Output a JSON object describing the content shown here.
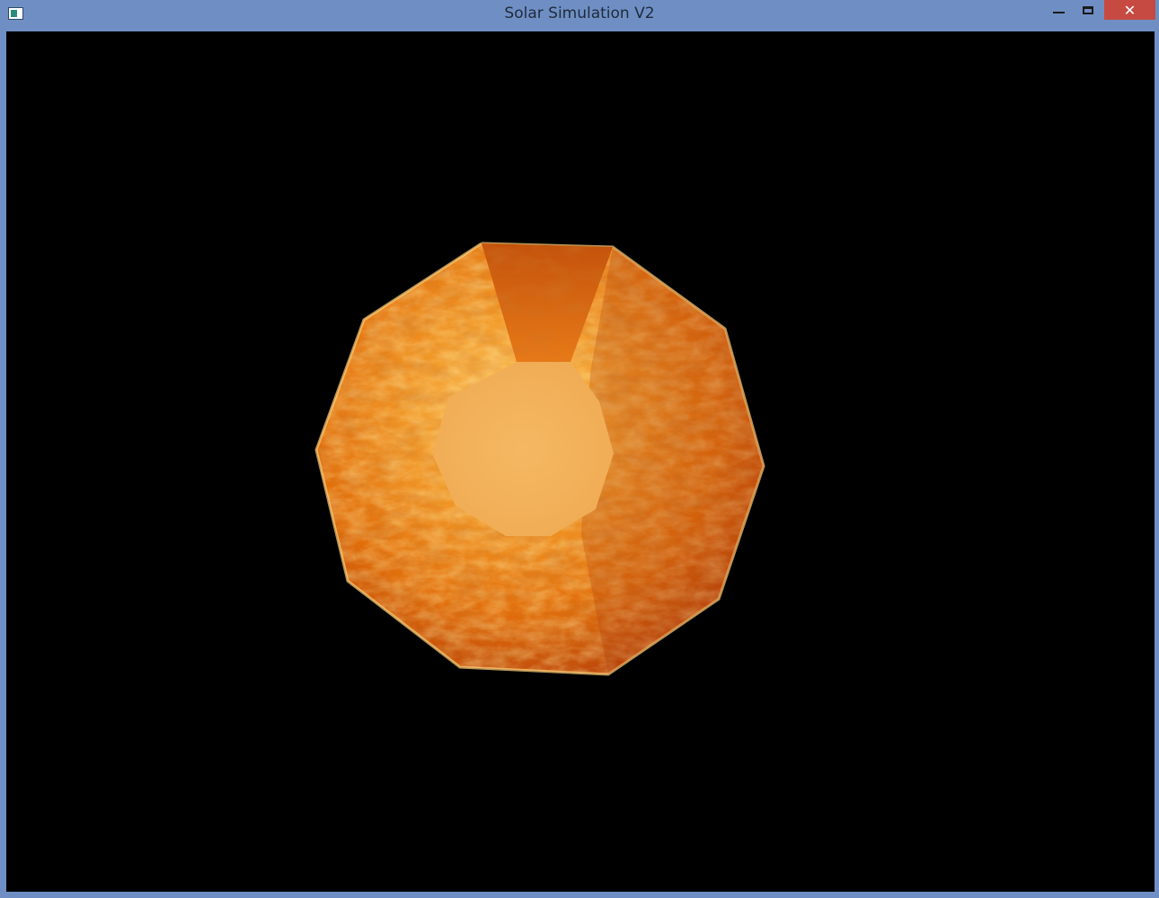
{
  "window": {
    "title": "Solar Simulation V2",
    "close_glyph": "✕"
  },
  "icons": {
    "app": "app-window-icon",
    "minimize": "minimize-icon",
    "maximize": "maximize-icon",
    "close": "close-icon"
  },
  "colors": {
    "titlebar": "#6f8fc4",
    "close_button": "#c74a42",
    "viewport_background": "#000000",
    "sun_outer": "#e8720f",
    "sun_core": "#f2b25e"
  }
}
